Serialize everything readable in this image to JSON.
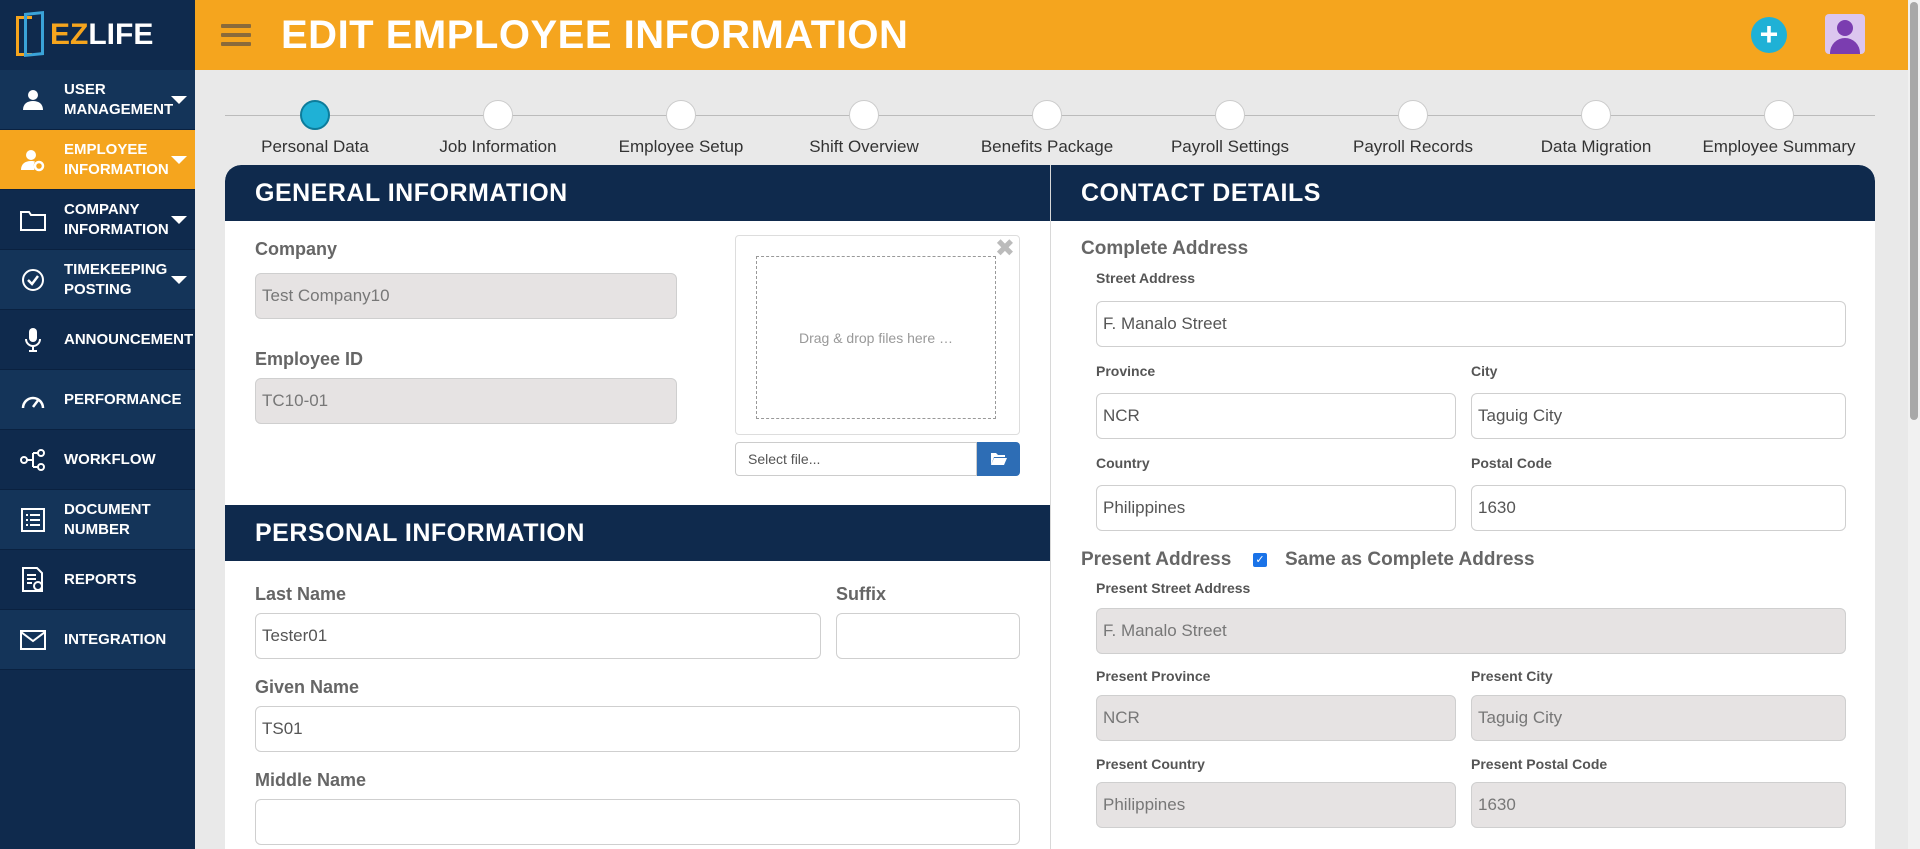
{
  "logo": {
    "ez": "EZ",
    "life": "LIFE"
  },
  "sidebar": {
    "items": [
      {
        "label_1": "USER",
        "label_2": "MANAGEMENT"
      },
      {
        "label_1": "EMPLOYEE",
        "label_2": "INFORMATION"
      },
      {
        "label_1": "COMPANY",
        "label_2": "INFORMATION"
      },
      {
        "label_1": "TIMEKEEPING",
        "label_2": "POSTING"
      },
      {
        "label_1": "ANNOUNCEMENT"
      },
      {
        "label_1": "PERFORMANCE"
      },
      {
        "label_1": "WORKFLOW"
      },
      {
        "label_1": "DOCUMENT",
        "label_2": "NUMBER"
      },
      {
        "label_1": "REPORTS"
      },
      {
        "label_1": "INTEGRATION"
      }
    ]
  },
  "header": {
    "title": "EDIT EMPLOYEE INFORMATION",
    "add_symbol": "+"
  },
  "steps": [
    {
      "label": "Personal Data",
      "active": true
    },
    {
      "label": "Job Information"
    },
    {
      "label": "Employee Setup"
    },
    {
      "label": "Shift Overview"
    },
    {
      "label": "Benefits Package"
    },
    {
      "label": "Payroll Settings"
    },
    {
      "label": "Payroll Records"
    },
    {
      "label": "Data Migration"
    },
    {
      "label": "Employee Summary"
    }
  ],
  "general": {
    "title": "GENERAL INFORMATION",
    "company_label": "Company",
    "company_value": "Test Company10",
    "employee_id_label": "Employee ID",
    "employee_id_value": "TC10-01",
    "dropzone_text": "Drag & drop files here …",
    "close_symbol": "✖",
    "select_file_placeholder": "Select file..."
  },
  "personal": {
    "title": "PERSONAL INFORMATION",
    "last_name_label": "Last Name",
    "last_name_value": "Tester01",
    "suffix_label": "Suffix",
    "suffix_value": "",
    "given_name_label": "Given Name",
    "given_name_value": "TS01",
    "middle_name_label": "Middle Name",
    "middle_name_value": ""
  },
  "contact": {
    "title": "CONTACT DETAILS",
    "complete_address_label": "Complete Address",
    "street_label": "Street Address",
    "street_value": "F. Manalo Street",
    "province_label": "Province",
    "province_value": "NCR",
    "city_label": "City",
    "city_value": "Taguig City",
    "country_label": "Country",
    "country_value": "Philippines",
    "postal_label": "Postal Code",
    "postal_value": "1630",
    "present_address_label": "Present Address",
    "same_as_label": "Same as Complete Address",
    "same_as_checked": true,
    "present_street_label": "Present Street Address",
    "present_street_value": "F. Manalo Street",
    "present_province_label": "Present Province",
    "present_province_value": "NCR",
    "present_city_label": "Present City",
    "present_city_value": "Taguig City",
    "present_country_label": "Present Country",
    "present_country_value": "Philippines",
    "present_postal_label": "Present Postal Code",
    "present_postal_value": "1630"
  },
  "colors": {
    "accent": "#f5a51e",
    "navy": "#0f2a4d",
    "step_active": "#1fb1d6"
  }
}
